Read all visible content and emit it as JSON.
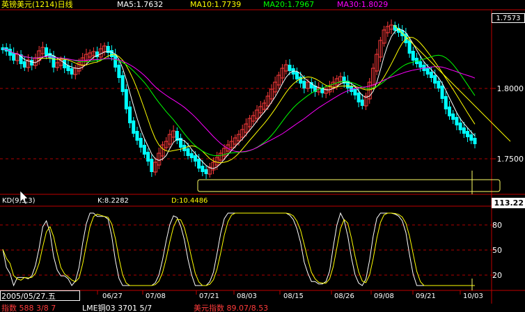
{
  "header": {
    "title": "英镑美元(1214)日线",
    "ma5": "MA5:1.7632",
    "ma10": "MA10:1.7739",
    "ma20": "MA20:1.7967",
    "ma30": "MA30:1.8029"
  },
  "price_axis": {
    "current": "1.7573",
    "levels": [
      "1.8000",
      "1.7500"
    ]
  },
  "kd": {
    "label": "KD(9,3,3)",
    "k": "K:8.2282",
    "d": "D:10.4486",
    "value_box": "113.22",
    "levels": [
      "80",
      "50",
      "20"
    ]
  },
  "date_axis": {
    "current_date": "2005/05/27.五",
    "ticks": [
      "06/27",
      "07/08",
      "07/21",
      "08/03",
      "08/15",
      "08/26",
      "09/08",
      "09/21",
      "10/03"
    ]
  },
  "bottom_bar": {
    "item1": "指数 588 3/8 7",
    "item2": "LME铜03 3701 5/7",
    "item3": "美元指数 89.07/8.53"
  },
  "colors": {
    "up": "#ff3b3b",
    "down": "#00ffff",
    "ma5": "#ffffff",
    "ma10": "#ffff00",
    "ma20": "#00ff00",
    "ma30": "#ff00ff",
    "grid": "#b00000",
    "axis": "#c00000"
  }
}
